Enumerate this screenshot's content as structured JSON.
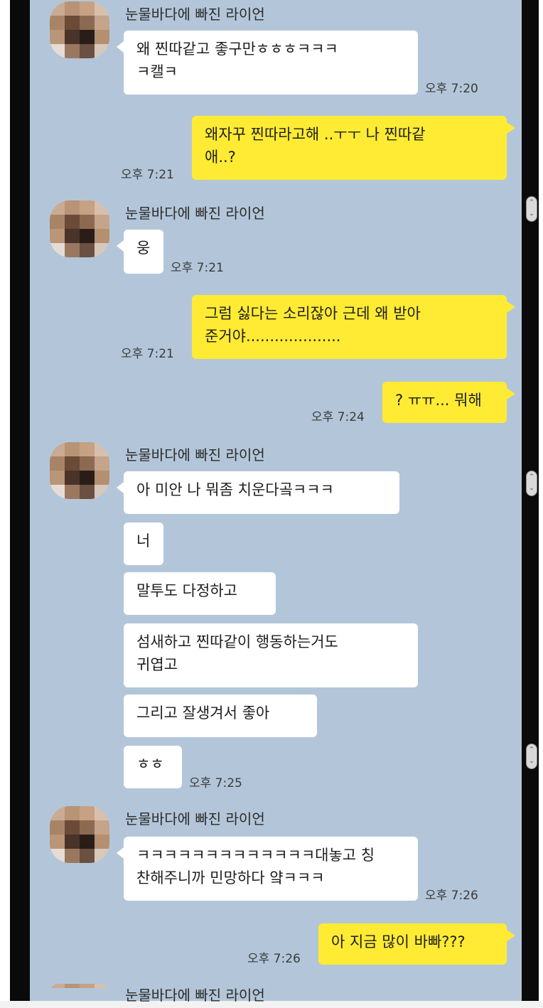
{
  "contact_name": "눈물바다에 빠진 라이언",
  "colors": {
    "chat_background": "#b3c6d9",
    "incoming_bubble": "#ffffff",
    "outgoing_bubble": "#ffeb33"
  },
  "messages": [
    {
      "side": "in",
      "lines": [
        "왜 찐따같고 좋구만ㅎㅎㅎㅋㅋㅋ",
        "ㅋ캘ㅋ"
      ],
      "time": "오후 7:20"
    },
    {
      "side": "out",
      "lines": [
        "왜자꾸 찐따라고해 ..ㅜㅜ 나 찐따같",
        "애..?"
      ],
      "time": "오후 7:21"
    },
    {
      "side": "in",
      "lines": [
        "웅"
      ],
      "time": "오후 7:21"
    },
    {
      "side": "out",
      "lines": [
        "그럼 싫다는 소리잖아 근데 왜 받아",
        "준거야...................."
      ],
      "time": "오후 7:21"
    },
    {
      "side": "out",
      "lines": [
        "? ㅠㅠ... 뭐해"
      ],
      "time": "오후 7:24"
    },
    {
      "side": "in",
      "lines": [
        "아 미안 나 뭐좀 치운다곸ㅋㅋㅋ"
      ]
    },
    {
      "side": "in",
      "lines": [
        "너"
      ]
    },
    {
      "side": "in",
      "lines": [
        "말투도 다정하고"
      ]
    },
    {
      "side": "in",
      "lines": [
        "섬새하고 찐따같이 행동하는거도",
        "귀엽고"
      ]
    },
    {
      "side": "in",
      "lines": [
        "그리고 잘생겨서 좋아"
      ]
    },
    {
      "side": "in",
      "lines": [
        "ㅎㅎ"
      ],
      "time": "오후 7:25"
    },
    {
      "side": "in",
      "lines": [
        "ㅋㅋㅋㅋㅋㅋㅋㅋㅋㅋㅋㅋㅋ대놓고 칭",
        "찬해주니까 민망하다 얔ㅋㅋㅋ"
      ],
      "time": "오후 7:26"
    },
    {
      "side": "out",
      "lines": [
        "아 지금 많이 바빠???"
      ],
      "time": "오후 7:26"
    }
  ]
}
